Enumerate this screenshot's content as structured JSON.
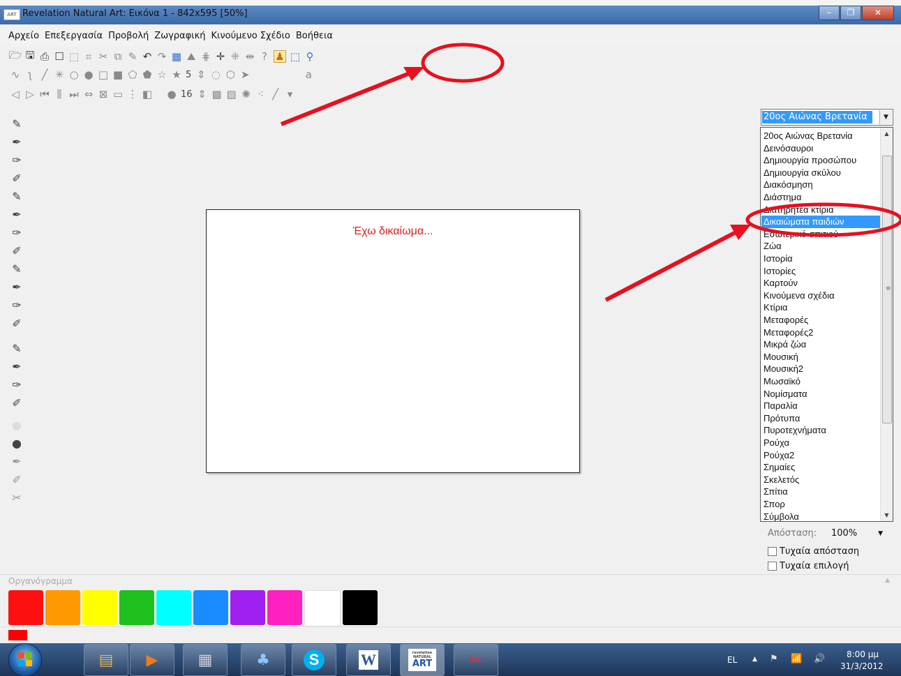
{
  "window": {
    "title": "Revelation Natural Art: Εικόνα 1 - 842x595 [50%]",
    "app_icon_text": "ART",
    "buttons": {
      "minimize": "–",
      "maximize": "❐",
      "close": "✕"
    }
  },
  "menu": {
    "items": [
      "Αρχείο",
      "Επεξεργασία",
      "Προβολή",
      "Ζωγραφική",
      "Κινούμενο Σχέδιο",
      "Βοήθεια"
    ]
  },
  "toolbar": {
    "shape_count": "5",
    "brush_size": "16"
  },
  "canvas": {
    "text": "Έχω δικαίωμα..."
  },
  "clipart": {
    "selected": "20ος Αιώνας Βρετανία",
    "items": [
      "20ος Αιώνας Βρετανία",
      "Δεινόσαυροι",
      "Δημιουργία προσώπου",
      "Δημιουργία σκύλου",
      "Διακόσμηση",
      "Διάστημα",
      "Διατηρητέα κτίρια",
      "Δικαιώματα παιδιών",
      "Εσωτερικό σπιτιού",
      "Ζώα",
      "Ιστορία",
      "Ιστορίες",
      "Καρτούν",
      "Κινούμενα σχέδια",
      "Κτίρια",
      "Μεταφορές",
      "Μεταφορές2",
      "Μικρά ζώα",
      "Μουσική",
      "Μουσική2",
      "Μωσαϊκό",
      "Νομίσματα",
      "Παραλία",
      "Πρότυπα",
      "Πυροτεχνήματα",
      "Ρούχα",
      "Ρούχα2",
      "Σημαίες",
      "Σκελετός",
      "Σπίτια",
      "Σπορ",
      "Σύμβολα"
    ],
    "highlighted_index": 7
  },
  "options": {
    "distance_label": "Απόσταση:",
    "distance_value": "100%",
    "random_distance": "Τυχαία απόσταση",
    "random_selection": "Τυχαία επιλογή"
  },
  "palette": {
    "label": "Οργανόγραμμα",
    "colors": [
      "#ff1010",
      "#ff9900",
      "#ffff00",
      "#1ec01e",
      "#00ffff",
      "#1a8cff",
      "#a020f0",
      "#ff20c0",
      "#ffffff",
      "#000000"
    ],
    "current": "#ff0000"
  },
  "taskbar": {
    "word_label": "W",
    "skype_label": "S",
    "art_label": "ART",
    "art_sub": "revelation NATURAL",
    "lang": "EL",
    "time": "8:00 μμ",
    "date": "31/3/2012"
  },
  "colors": {
    "annotation": "#e8101e",
    "selection": "#3399ff"
  }
}
